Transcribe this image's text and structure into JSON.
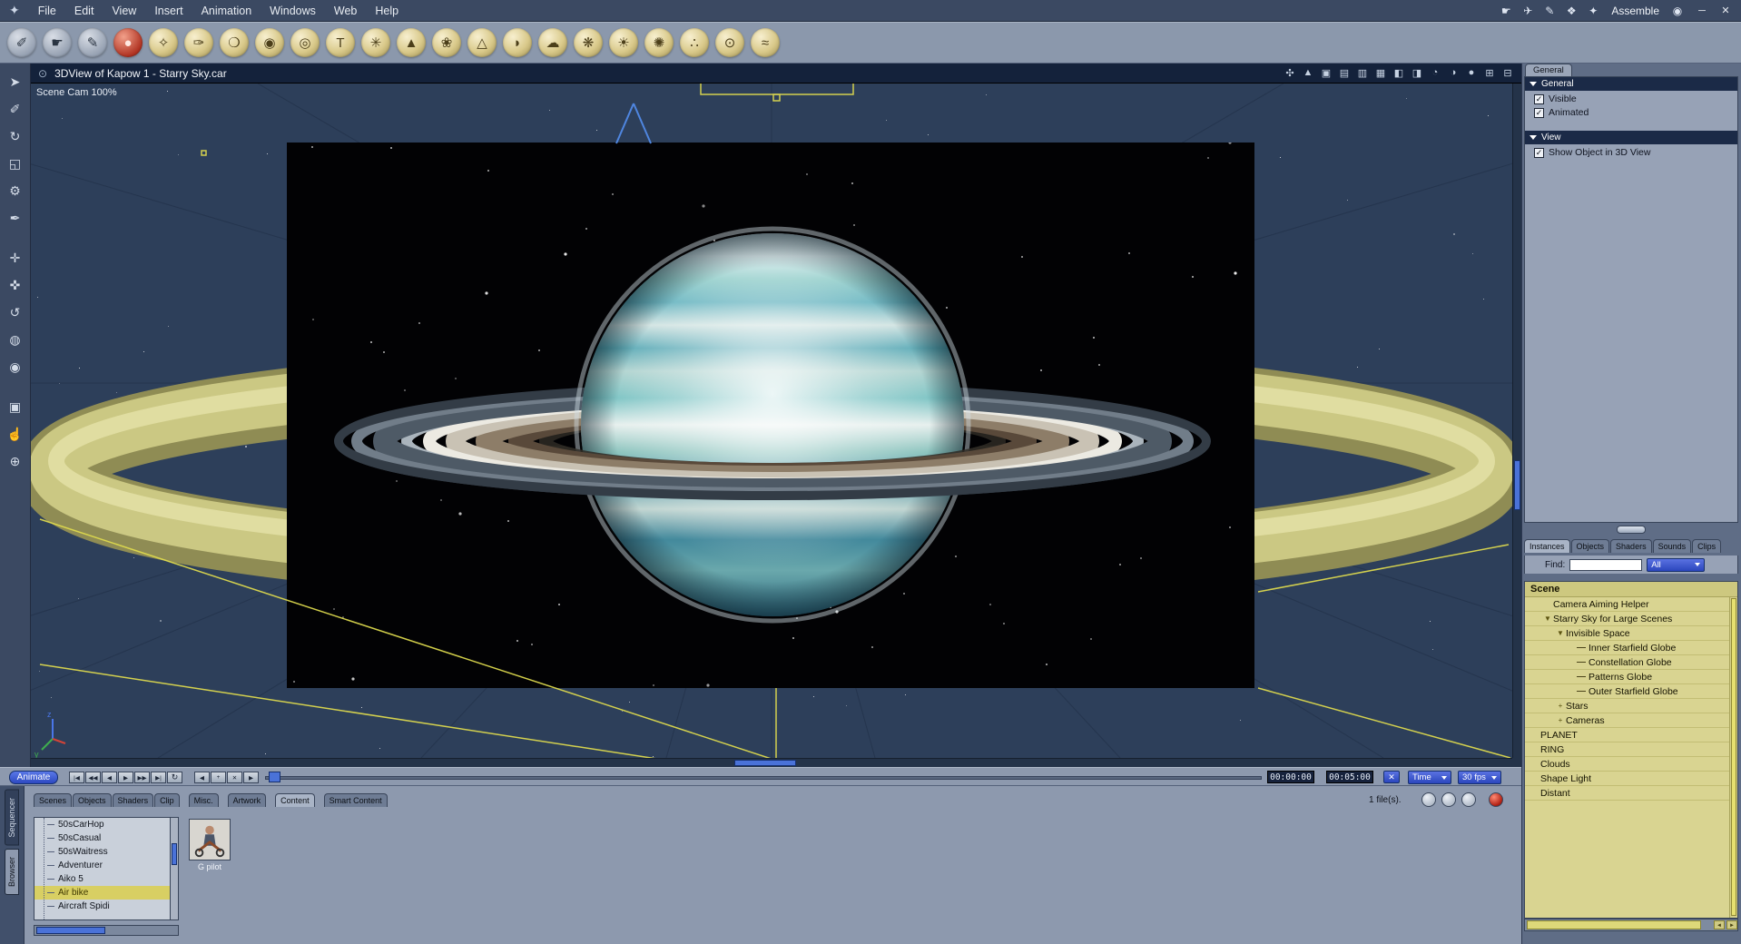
{
  "window": {
    "logo_glyph": "✦",
    "menu_items": [
      "File",
      "Edit",
      "View",
      "Insert",
      "Animation",
      "Windows",
      "Web",
      "Help"
    ],
    "right_icons": [
      {
        "name": "hand-cursor-icon",
        "glyph": "☛"
      },
      {
        "name": "room-icon-1",
        "glyph": "✈"
      },
      {
        "name": "room-icon-2",
        "glyph": "✎"
      },
      {
        "name": "room-icon-3",
        "glyph": "❖"
      },
      {
        "name": "room-icon-4",
        "glyph": "✦"
      }
    ],
    "room_label": "Assemble",
    "eye_glyph": "◉",
    "minimize_glyph": "─",
    "close_glyph": "✕"
  },
  "toolbar": {
    "icons": [
      {
        "name": "wire-edit-icon",
        "glyph": "✐",
        "tone": "gray"
      },
      {
        "name": "drag-icon",
        "glyph": "☛",
        "tone": "gray"
      },
      {
        "name": "paint-icon",
        "glyph": "✎",
        "tone": "gray"
      },
      {
        "name": "insert-figure-icon",
        "glyph": "●",
        "tone": "red"
      },
      {
        "name": "insert-vertex-object-icon",
        "glyph": "✧",
        "tone": "gold"
      },
      {
        "name": "insert-spline-object-icon",
        "glyph": "✑",
        "tone": "gold"
      },
      {
        "name": "insert-metaball-icon",
        "glyph": "❍",
        "tone": "gold"
      },
      {
        "name": "insert-sphere-icon",
        "glyph": "◉",
        "tone": "gold"
      },
      {
        "name": "insert-torus-icon",
        "glyph": "◎",
        "tone": "gold"
      },
      {
        "name": "insert-text-icon",
        "glyph": "T",
        "tone": "gold"
      },
      {
        "name": "insert-particles-icon",
        "glyph": "✳",
        "tone": "gold"
      },
      {
        "name": "insert-cone-icon",
        "glyph": "▲",
        "tone": "gold"
      },
      {
        "name": "insert-plant-icon",
        "glyph": "❀",
        "tone": "gold"
      },
      {
        "name": "insert-terrain-icon",
        "glyph": "△",
        "tone": "gold"
      },
      {
        "name": "insert-liquid-icon",
        "glyph": "◗",
        "tone": "gold"
      },
      {
        "name": "insert-cloud-icon",
        "glyph": "☁",
        "tone": "gold"
      },
      {
        "name": "insert-fire-icon",
        "glyph": "❋",
        "tone": "gold"
      },
      {
        "name": "insert-sun-icon",
        "glyph": "☀",
        "tone": "gold"
      },
      {
        "name": "insert-starburst-icon",
        "glyph": "✺",
        "tone": "gold"
      },
      {
        "name": "insert-path-icon",
        "glyph": "∴",
        "tone": "gold"
      },
      {
        "name": "insert-target-icon",
        "glyph": "⊙",
        "tone": "gold"
      },
      {
        "name": "insert-ocean-icon",
        "glyph": "≈",
        "tone": "gold"
      }
    ]
  },
  "left_tools": [
    {
      "name": "move-tool-icon",
      "glyph": "➤"
    },
    {
      "name": "point-edit-tool-icon",
      "glyph": "✐"
    },
    {
      "name": "rotate-tool-icon",
      "glyph": "↻"
    },
    {
      "name": "scale-tool-icon",
      "glyph": "◱"
    },
    {
      "name": "wrench-tool-icon",
      "glyph": "⚙"
    },
    {
      "name": "eyedropper-tool-icon",
      "glyph": "✒"
    },
    {
      "name": "camera-translate-icon",
      "glyph": "✛",
      "gap": true
    },
    {
      "name": "camera-pan-icon",
      "glyph": "✜"
    },
    {
      "name": "camera-bank-icon",
      "glyph": "↺"
    },
    {
      "name": "camera-track-icon",
      "glyph": "◍"
    },
    {
      "name": "camera-dolly-icon",
      "glyph": "◉"
    },
    {
      "name": "render-area-icon",
      "glyph": "▣",
      "gap": true
    },
    {
      "name": "pan-hand-icon",
      "glyph": "☝"
    },
    {
      "name": "zoom-tool-icon",
      "glyph": "⊕"
    }
  ],
  "viewport": {
    "menu_icon_glyph": "⊙",
    "title": "3DView of Kapow 1 -  Starry Sky.car",
    "camera_label": "Scene Cam 100%",
    "axis": {
      "z": "z",
      "y": "y"
    },
    "nav_icons": [
      {
        "name": "production-frame-icon",
        "glyph": "✣"
      },
      {
        "name": "camera-gizmo-icon",
        "glyph": "▲"
      },
      {
        "name": "layout-single-icon",
        "glyph": "▣"
      },
      {
        "name": "layout-rows-icon",
        "glyph": "▤"
      },
      {
        "name": "layout-columns-icon",
        "glyph": "▥"
      },
      {
        "name": "layout-quad-icon",
        "glyph": "▦"
      },
      {
        "name": "shade-left-icon",
        "glyph": "◧"
      },
      {
        "name": "shade-right-icon",
        "glyph": "◨"
      },
      {
        "name": "quality-wire-icon",
        "glyph": "◔"
      },
      {
        "name": "quality-flat-icon",
        "glyph": "◑"
      },
      {
        "name": "quality-full-icon",
        "glyph": "●"
      },
      {
        "name": "grid-toggle-icon",
        "glyph": "⊞"
      },
      {
        "name": "plane-toggle-icon",
        "glyph": "⊟"
      }
    ]
  },
  "right_panel": {
    "top_tab": "General",
    "general_title": "General",
    "general_checks": [
      {
        "label": "Visible",
        "mark": "✓"
      },
      {
        "label": "Animated",
        "mark": "✓"
      }
    ],
    "view_title": "View",
    "view_checks": [
      {
        "label": "Show Object in 3D View",
        "mark": "✓"
      }
    ],
    "tabs": [
      "Instances",
      "Objects",
      "Shaders",
      "Sounds",
      "Clips"
    ],
    "active_tab": "Instances",
    "find_label": "Find:",
    "filter_value": "All",
    "scene_header": "Scene",
    "tree": [
      {
        "label": "Camera Aiming Helper",
        "indent": 1,
        "expander": "none"
      },
      {
        "label": "Starry Sky for Large Scenes",
        "indent": 1,
        "expander": "open"
      },
      {
        "label": "Invisible Space",
        "indent": 2,
        "expander": "open"
      },
      {
        "label": "Inner Starfield Globe",
        "indent": 3,
        "expander": "none",
        "branch": true
      },
      {
        "label": "Constellation Globe",
        "indent": 3,
        "expander": "none",
        "branch": true
      },
      {
        "label": "Patterns Globe",
        "indent": 3,
        "expander": "none",
        "branch": true
      },
      {
        "label": "Outer Starfield Globe",
        "indent": 3,
        "expander": "none",
        "branch": true
      },
      {
        "label": "Stars",
        "indent": 2,
        "expander": "closed"
      },
      {
        "label": "Cameras",
        "indent": 2,
        "expander": "closed"
      },
      {
        "label": "PLANET",
        "indent": 0,
        "expander": "none"
      },
      {
        "label": "RING",
        "indent": 0,
        "expander": "none"
      },
      {
        "label": "Clouds",
        "indent": 0,
        "expander": "none"
      },
      {
        "label": "Shape Light",
        "indent": 0,
        "expander": "none"
      },
      {
        "label": "Distant",
        "indent": 0,
        "expander": "none"
      }
    ]
  },
  "timeline": {
    "animate_label": "Animate",
    "transport": [
      {
        "name": "go-start-button",
        "glyph": "|◀"
      },
      {
        "name": "frame-back-button",
        "glyph": "◀◀"
      },
      {
        "name": "play-reverse-button",
        "glyph": "◀"
      },
      {
        "name": "play-button",
        "glyph": "▶"
      },
      {
        "name": "frame-forward-button",
        "glyph": "▶▶"
      },
      {
        "name": "go-end-button",
        "glyph": "▶|"
      }
    ],
    "loop_glyph": "↻",
    "key_buttons": [
      {
        "name": "prev-keyframe-button",
        "glyph": "◀"
      },
      {
        "name": "add-keyframe-button",
        "glyph": "+"
      },
      {
        "name": "delete-keyframe-button",
        "glyph": "✕"
      },
      {
        "name": "next-keyframe-button",
        "glyph": "▶"
      }
    ],
    "current_time": "00:00:00",
    "end_time": "00:05:00",
    "close_glyph": "✕",
    "time_mode": "Time",
    "fps": "30 fps"
  },
  "browser": {
    "side_tabs": [
      "Sequencer",
      "Browser"
    ],
    "active_side": "Browser",
    "tabs": [
      {
        "label": "Scenes"
      },
      {
        "label": "Objects"
      },
      {
        "label": "Shaders"
      },
      {
        "label": "Clip"
      },
      {
        "label": "Misc.",
        "gap": true
      },
      {
        "label": "Artwork",
        "gap": true
      },
      {
        "label": "Content",
        "gap": true
      },
      {
        "label": "Smart Content",
        "gap": true
      }
    ],
    "active_tab": "Content",
    "file_count": "1 file(s).",
    "list_items": [
      "50sCarHop",
      "50sCasual",
      "50sWaitress",
      "Adventurer",
      "Aiko 5",
      "Air bike",
      "Aircraft Spidi"
    ],
    "selected_item": "Air bike",
    "thumbnail_label": "G pilot"
  }
}
